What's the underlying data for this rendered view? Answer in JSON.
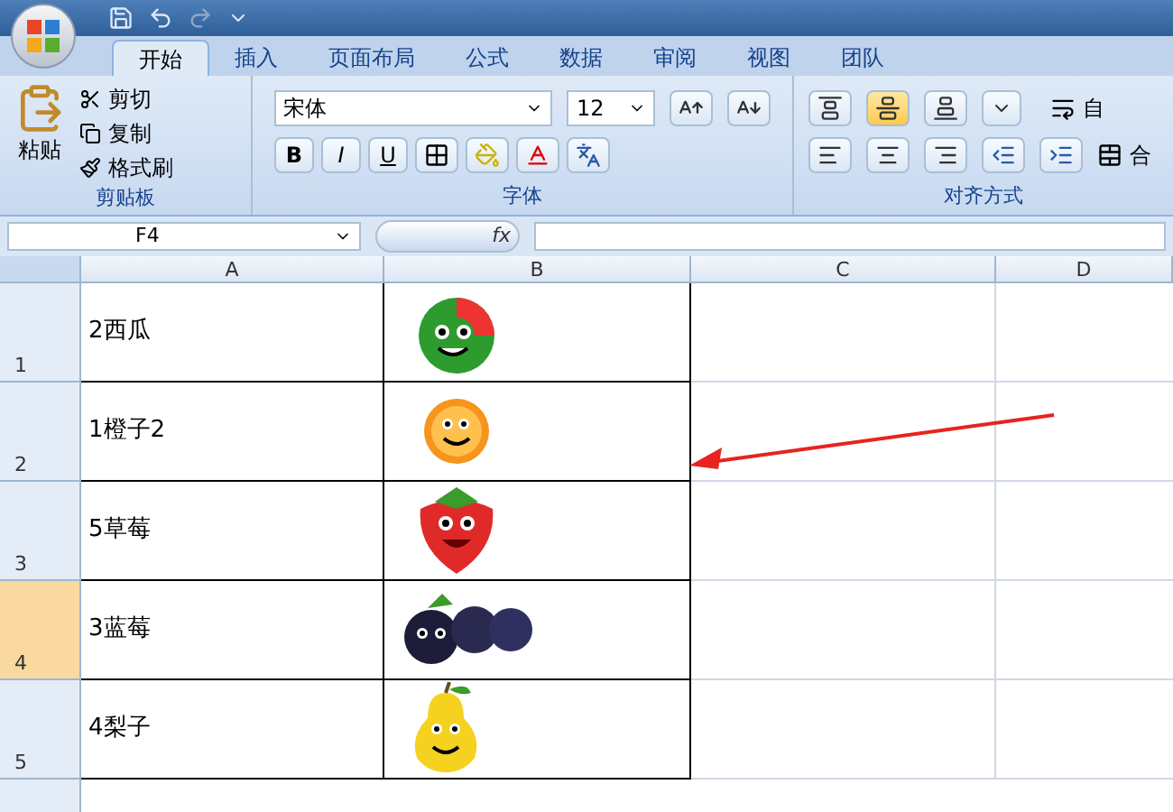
{
  "tabs": [
    {
      "label": "开始",
      "selected": true
    },
    {
      "label": "插入",
      "selected": false
    },
    {
      "label": "页面布局",
      "selected": false
    },
    {
      "label": "公式",
      "selected": false
    },
    {
      "label": "数据",
      "selected": false
    },
    {
      "label": "审阅",
      "selected": false
    },
    {
      "label": "视图",
      "selected": false
    },
    {
      "label": "团队",
      "selected": false
    }
  ],
  "clipboard": {
    "paste": "粘贴",
    "cut": "剪切",
    "copy": "复制",
    "format_painter": "格式刷",
    "label": "剪贴板"
  },
  "font": {
    "name": "宋体",
    "size": "12",
    "bold": "B",
    "italic": "I",
    "underline": "U",
    "label": "字体"
  },
  "alignment": {
    "label": "对齐方式",
    "wrap_partial": "自",
    "merge_partial": "合"
  },
  "formula_bar": {
    "name_box": "F4",
    "fx": "fx"
  },
  "columns": [
    "A",
    "B",
    "C",
    "D"
  ],
  "rows": [
    {
      "number": "1",
      "a": "2西瓜",
      "kind": "watermelon",
      "selected": false
    },
    {
      "number": "2",
      "a": "1橙子2",
      "kind": "orange",
      "selected": false
    },
    {
      "number": "3",
      "a": "5草莓",
      "kind": "strawberry",
      "selected": false
    },
    {
      "number": "4",
      "a": "3蓝莓",
      "kind": "blueberry",
      "selected": true
    },
    {
      "number": "5",
      "a": "4梨子",
      "kind": "pear",
      "selected": false
    }
  ]
}
